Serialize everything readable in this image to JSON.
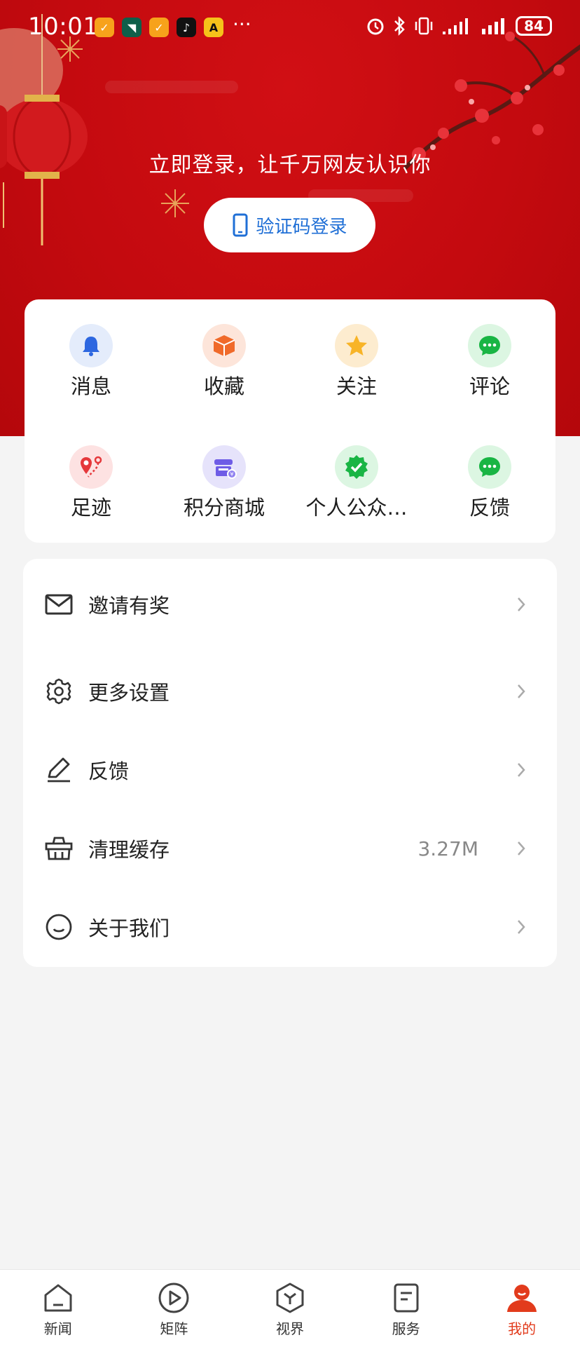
{
  "status_bar": {
    "time": "10:01",
    "more": "···",
    "battery": "84",
    "app_icons": [
      "orange-app-icon",
      "green-app-icon",
      "orange-app-icon-2",
      "tiktok-icon",
      "yellow-app-icon"
    ],
    "system_icons": [
      "alarm-icon",
      "bluetooth-icon",
      "vibrate-icon",
      "signal-icon",
      "signal-icon-2",
      "battery-icon"
    ]
  },
  "header": {
    "slogan": "立即登录，让千万网友认识你",
    "login_button": "验证码登录"
  },
  "quick_actions": [
    {
      "label": "消息",
      "icon": "bell-icon"
    },
    {
      "label": "收藏",
      "icon": "box-icon"
    },
    {
      "label": "关注",
      "icon": "star-icon"
    },
    {
      "label": "评论",
      "icon": "chat-icon"
    },
    {
      "label": "足迹",
      "icon": "location-icon"
    },
    {
      "label": "积分商城",
      "icon": "store-icon"
    },
    {
      "label": "个人公众…",
      "icon": "verified-icon"
    },
    {
      "label": "反馈",
      "icon": "chat-icon"
    }
  ],
  "menu": [
    {
      "label": "邀请有奖",
      "value": "",
      "icon": "mail-icon"
    },
    {
      "label": "更多设置",
      "value": "",
      "icon": "gear-icon"
    },
    {
      "label": "反馈",
      "value": "",
      "icon": "pencil-icon"
    },
    {
      "label": "清理缓存",
      "value": "3.27M",
      "icon": "basket-icon"
    },
    {
      "label": "关于我们",
      "value": "",
      "icon": "smile-icon"
    }
  ],
  "tabs": [
    {
      "label": "新闻",
      "icon": "home-icon",
      "active": false
    },
    {
      "label": "矩阵",
      "icon": "play-icon",
      "active": false
    },
    {
      "label": "视界",
      "icon": "cube-icon",
      "active": false
    },
    {
      "label": "服务",
      "icon": "document-icon",
      "active": false
    },
    {
      "label": "我的",
      "icon": "profile-icon",
      "active": true
    }
  ],
  "colors": {
    "brand_red": "#c40a0f",
    "accent_active": "#e23b1c",
    "login_text": "#1f6fd6"
  }
}
